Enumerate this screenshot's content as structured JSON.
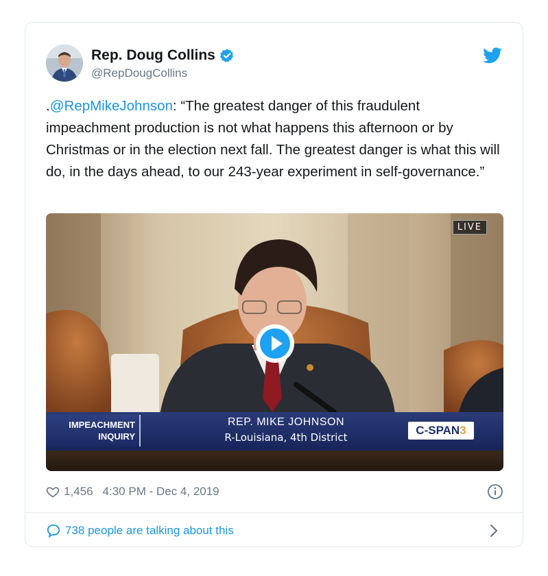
{
  "tweet": {
    "display_name": "Rep. Doug Collins",
    "handle": "@RepDougCollins",
    "text_prefix": ".",
    "mention": "@RepMikeJohnson",
    "text_body": ": “The greatest danger of this fraudulent impeachment production is not what happens this afternoon or by Christmas or in the election next fall. The greatest danger is what this will do, in the days ahead, to our 243-year experiment in self-governance.”",
    "likes": "1,456",
    "timestamp": "4:30 PM - Dec 4, 2019",
    "talking": "738 people are talking about this"
  },
  "video": {
    "live_label": "LIVE",
    "banner_left_line1": "IMPEACHMENT",
    "banner_left_line2": "INQUIRY",
    "banner_name": "REP. MIKE JOHNSON",
    "banner_sub": "R-Louisiana, 4th District",
    "channel_main": "C-SPAN",
    "channel_num": "3"
  },
  "icons": {
    "verified": "verified-badge-icon",
    "bird": "twitter-bird-icon",
    "play": "play-icon",
    "heart": "heart-icon",
    "info": "info-icon",
    "bubble": "speech-bubble-icon",
    "chevron": "chevron-right-icon"
  },
  "colors": {
    "accent": "#1b95e0",
    "muted": "#657786",
    "text": "#14171a",
    "border": "#e1e8ed"
  }
}
